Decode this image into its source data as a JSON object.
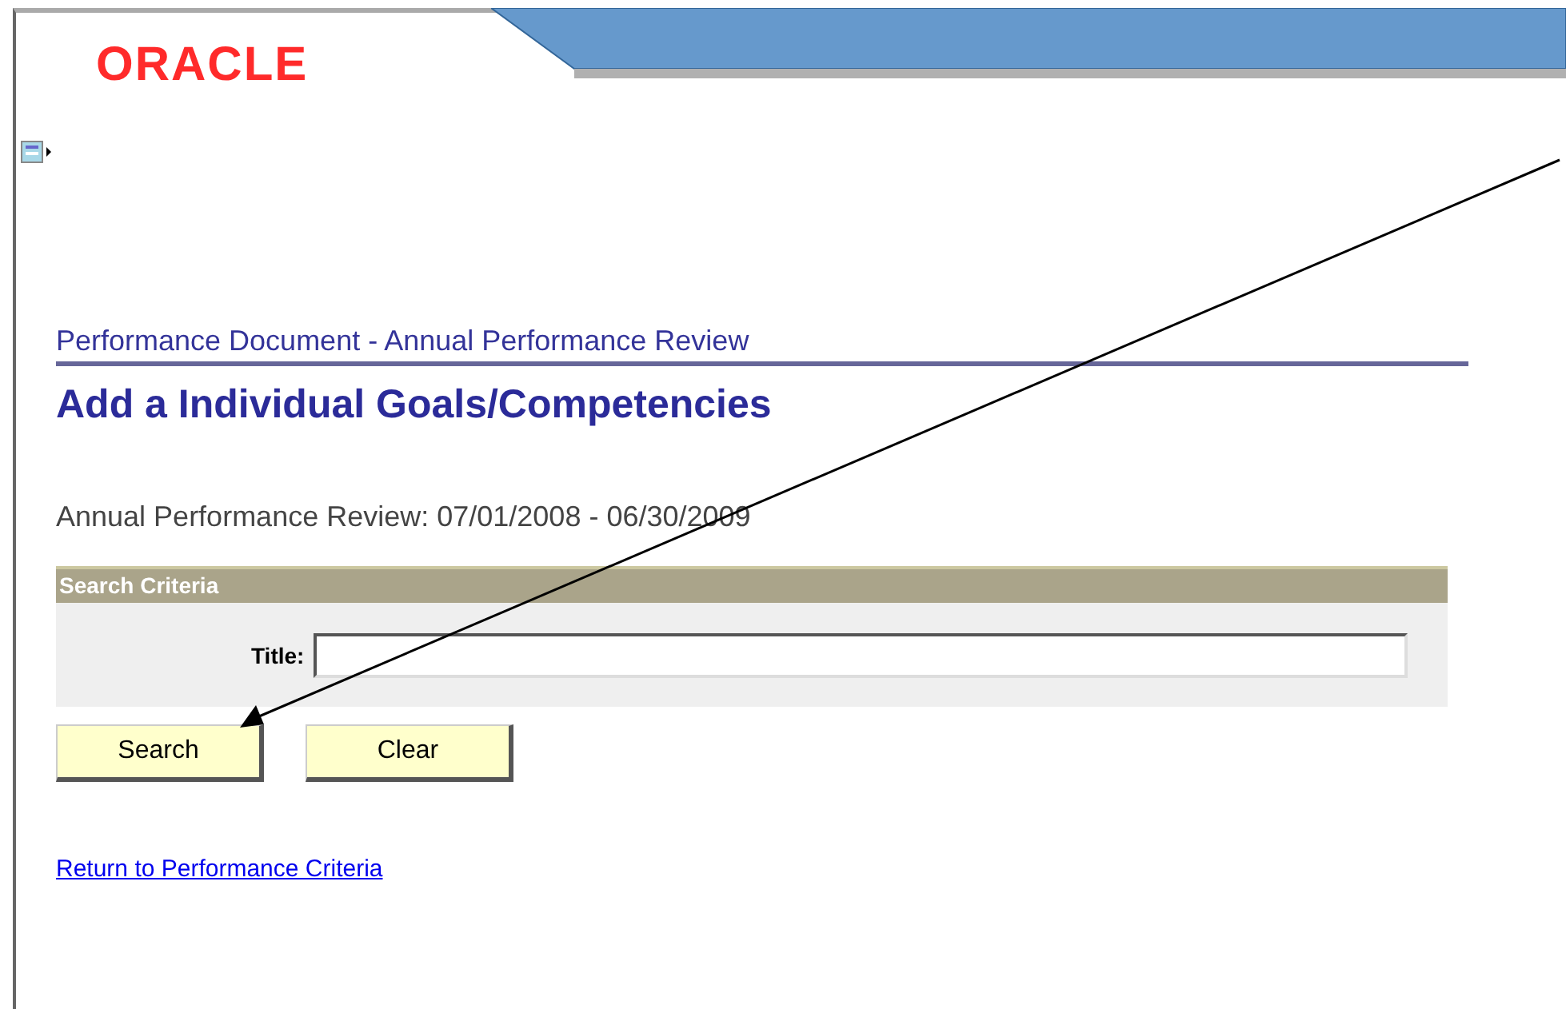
{
  "header": {
    "logo": "ORACLE"
  },
  "breadcrumb": "Performance Document - Annual Performance Review",
  "heading": "Add a Individual Goals/Competencies",
  "period": "Annual Performance Review: 07/01/2008 - 06/30/2009",
  "search_criteria": {
    "title": "Search Criteria",
    "fields": [
      {
        "label": "Title:"
      }
    ]
  },
  "buttons": [
    "Search",
    "Clear"
  ],
  "link": "Return to Performance Criteria"
}
